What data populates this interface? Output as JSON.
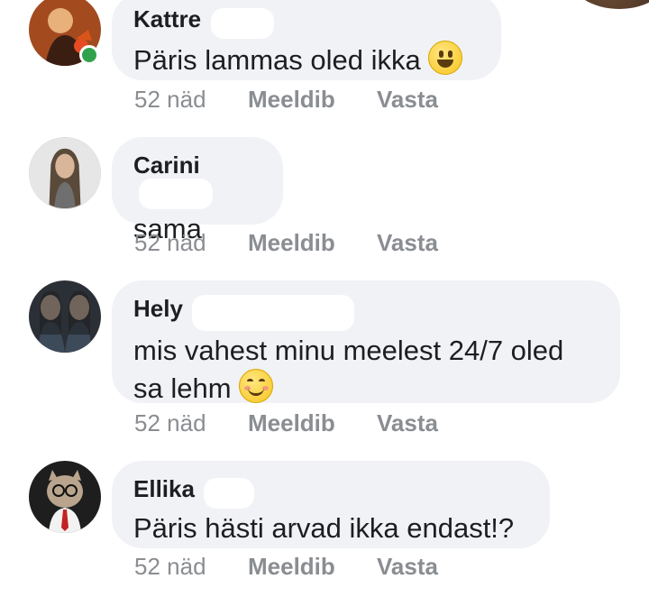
{
  "comments": [
    {
      "author": "Kattre",
      "text": "Päris lammas oled ikka",
      "emoji": "grinning-face-emoji",
      "online": true,
      "time": "52 näd",
      "like_label": "Meeldib",
      "reply_label": "Vasta"
    },
    {
      "author": "Carini",
      "text": "sama",
      "time": "52 näd",
      "like_label": "Meeldib",
      "reply_label": "Vasta"
    },
    {
      "author": "Hely",
      "text_line1": "mis vahest minu meelest 24/7 oled",
      "text_line2": "sa lehm",
      "emoji": "smiling-face-with-smiling-eyes-emoji",
      "time": "52 näd",
      "like_label": "Meeldib",
      "reply_label": "Vasta"
    },
    {
      "author": "Ellika",
      "text": "Päris hästi arvad ikka endast!?",
      "time": "52 näd",
      "like_label": "Meeldib",
      "reply_label": "Vasta"
    }
  ],
  "colors": {
    "bubble": "#f0f2f5",
    "meta_text": "#8a8d91",
    "online": "#31a24c"
  }
}
